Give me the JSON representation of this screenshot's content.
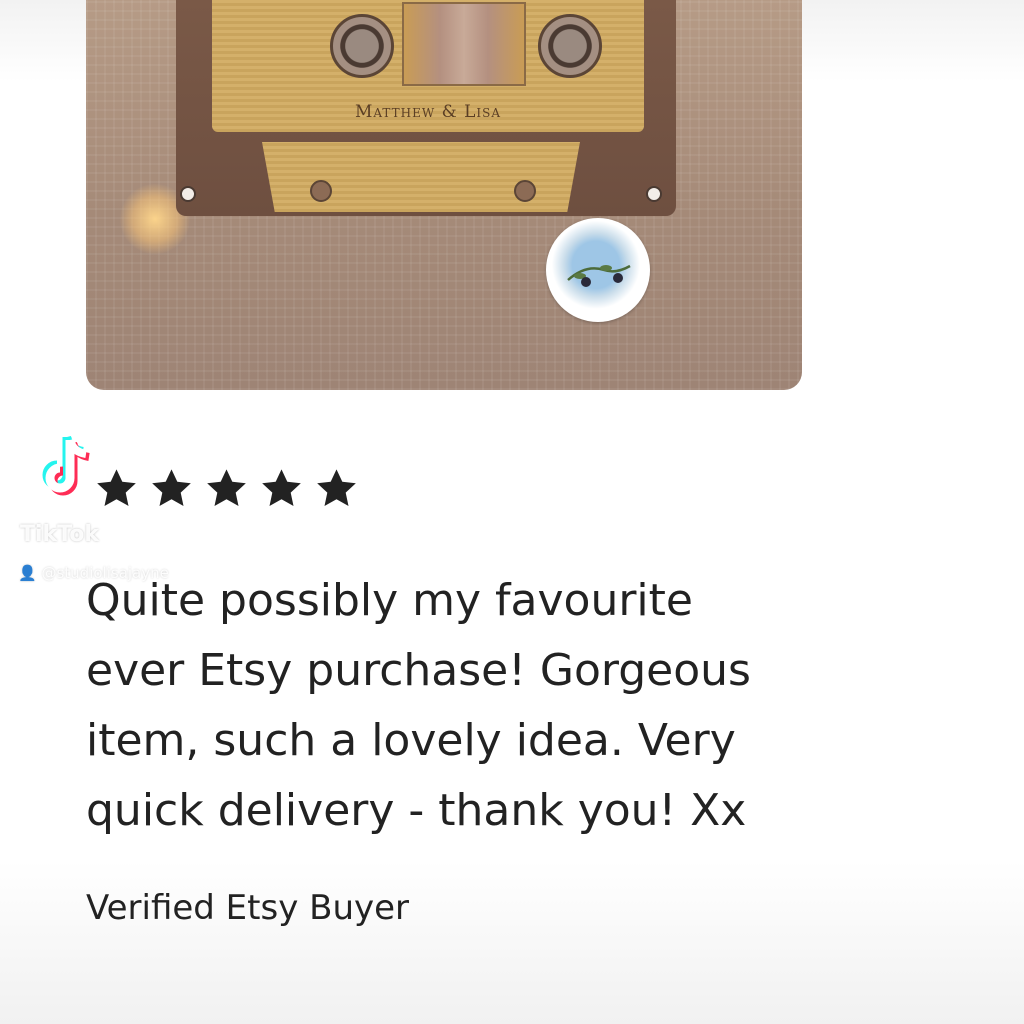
{
  "product_image": {
    "alt": "Wooden cassette tape gift",
    "engraving": "Matthew & Lisa"
  },
  "watermark": {
    "brand": "TikTok",
    "handle": "@studiolisajayne"
  },
  "rating": {
    "stars": 5,
    "max": 5,
    "color": "#222222"
  },
  "review": {
    "lines": [
      "Quite possibly my favourite",
      "ever Etsy purchase! Gorgeous",
      "item, such a lovely idea. Very",
      "quick delivery - thank you! Xx"
    ],
    "author": "Verified Etsy Buyer"
  },
  "colors": {
    "text": "#222222",
    "background": "#ffffff",
    "tiktok_cyan": "#25f4ee",
    "tiktok_red": "#fe2c55"
  }
}
